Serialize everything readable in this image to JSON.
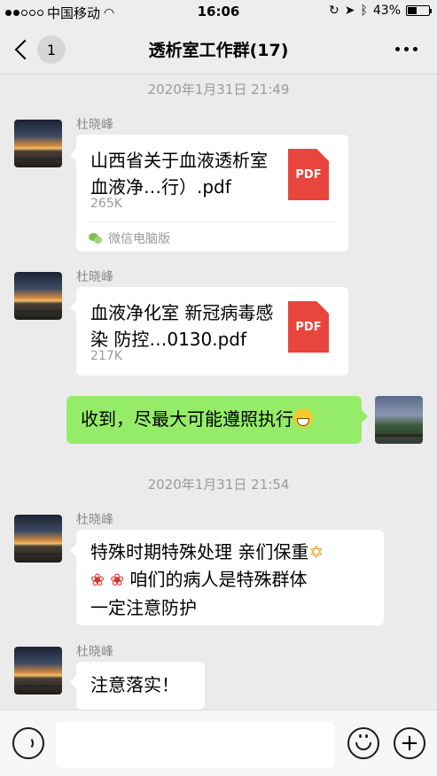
{
  "status_bar": {
    "carrier": "中国移动",
    "time": "16:06",
    "battery": "43%",
    "battery_level": 0.43
  },
  "nav": {
    "unread_count": "1",
    "title": "透析室工作群(17)"
  },
  "messages": {
    "ts1": "2020年1月31日 21:49",
    "ts2": "2020年1月31日 21:54",
    "m1": {
      "sender": "杜晓峰",
      "file_name": "山西省关于血液透析室血液净…行）.pdf",
      "file_size": "265K",
      "source": "微信电脑版",
      "icon_label": "PDF"
    },
    "m2": {
      "sender": "杜晓峰",
      "file_name": "血液净化室 新冠病毒感染 防控…0130.pdf",
      "file_size": "217K",
      "icon_label": "PDF"
    },
    "m3": {
      "text": "收到，尽最大可能遵照执行"
    },
    "m4": {
      "sender": "杜晓峰",
      "line1": "特殊时期特殊处理  亲们保重",
      "line2": "  咱们的病人是特殊群体",
      "line3": "一定注意防护"
    },
    "m5": {
      "sender": "杜晓峰",
      "text": "注意落实！"
    }
  },
  "colors": {
    "sent_bubble": "#95ec69",
    "pdf_icon": "#e8453c",
    "chat_bg": "#ebebeb"
  }
}
